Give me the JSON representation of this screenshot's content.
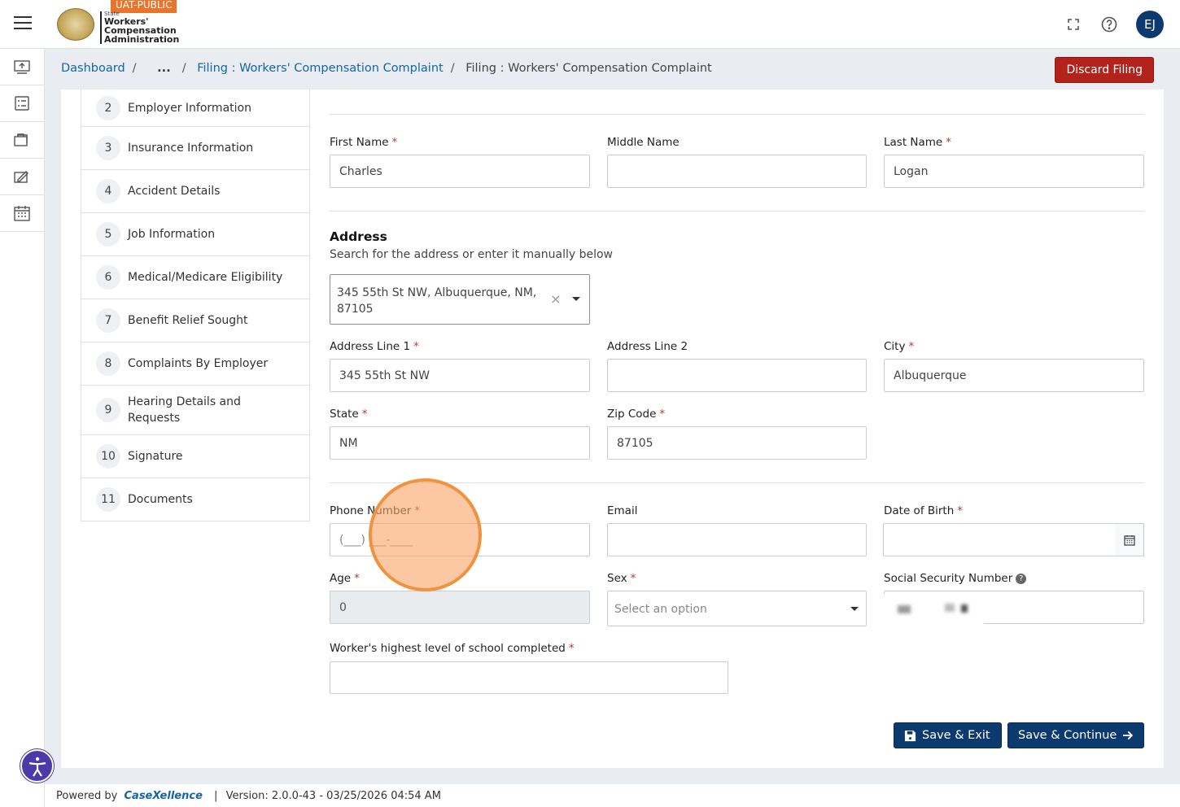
{
  "header": {
    "env_badge": "UAT-PUBLIC",
    "logo_small": "State",
    "logo_line1": "Workers'",
    "logo_line2": "Compensation",
    "logo_line3": "Administration",
    "avatar_initials": "EJ"
  },
  "breadcrumb": {
    "dashboard": "Dashboard",
    "ellipsis": "...",
    "parent": "Filing : Workers' Compensation Complaint",
    "current": "Filing : Workers' Compensation Complaint"
  },
  "actions": {
    "discard": "Discard Filing",
    "save_exit": "Save & Exit",
    "save_continue": "Save & Continue"
  },
  "steps": [
    {
      "num": "2",
      "label": "Employer Information"
    },
    {
      "num": "3",
      "label": "Insurance Information"
    },
    {
      "num": "4",
      "label": "Accident Details"
    },
    {
      "num": "5",
      "label": "Job Information"
    },
    {
      "num": "6",
      "label": "Medical/Medicare Eligibility"
    },
    {
      "num": "7",
      "label": "Benefit Relief Sought"
    },
    {
      "num": "8",
      "label": "Complaints By Employer"
    },
    {
      "num": "9",
      "label": "Hearing Details and Requests"
    },
    {
      "num": "10",
      "label": "Signature"
    },
    {
      "num": "11",
      "label": "Documents"
    }
  ],
  "form": {
    "first_name": {
      "label": "First Name",
      "value": "Charles"
    },
    "middle_name": {
      "label": "Middle Name",
      "value": ""
    },
    "last_name": {
      "label": "Last Name",
      "value": "Logan"
    },
    "address": {
      "title": "Address",
      "subtitle": "Search for the address or enter it manually below",
      "search_value": "345 55th St NW, Albuquerque, NM, 87105"
    },
    "address_line1": {
      "label": "Address Line 1",
      "value": "345 55th St NW"
    },
    "address_line2": {
      "label": "Address Line 2",
      "value": ""
    },
    "city": {
      "label": "City",
      "value": "Albuquerque"
    },
    "state": {
      "label": "State",
      "value": "NM"
    },
    "zip": {
      "label": "Zip Code",
      "value": "87105"
    },
    "phone": {
      "label": "Phone Number",
      "placeholder": "(___) ___-____"
    },
    "email": {
      "label": "Email",
      "value": ""
    },
    "dob": {
      "label": "Date of Birth",
      "value": ""
    },
    "age": {
      "label": "Age",
      "value": "0"
    },
    "sex": {
      "label": "Sex",
      "placeholder": "Select an option"
    },
    "ssn": {
      "label": "Social Security Number"
    },
    "school": {
      "label": "Worker's highest level of school completed",
      "value": ""
    }
  },
  "footer": {
    "powered_by": "Powered by",
    "brand": "CaseXellence",
    "sep": "|",
    "version": "Version: 2.0.0-43 - 03/25/2026 04:54 AM"
  },
  "colors": {
    "primary": "#0d3a6e",
    "link": "#1565a7",
    "danger": "#b3221b",
    "badge": "#e8752b",
    "required": "#c0392b"
  }
}
